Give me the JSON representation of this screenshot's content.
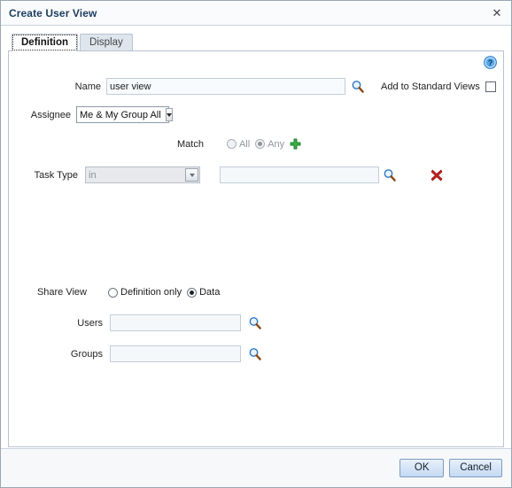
{
  "dialog": {
    "title": "Create User View",
    "close_label": "✕"
  },
  "tabs": [
    {
      "label": "Definition",
      "active": true
    },
    {
      "label": "Display",
      "active": false
    }
  ],
  "help": {
    "icon": "help-question-icon",
    "glyph": "?"
  },
  "form": {
    "name": {
      "label": "Name",
      "value": "user view",
      "placeholder": "",
      "search_icon": "magnifier-icon"
    },
    "add_to_standard_views": {
      "label": "Add to Standard Views",
      "checked": false
    },
    "assignee": {
      "label": "Assignee",
      "value": "Me & My Group All",
      "options": [
        "Me & My Group All"
      ]
    },
    "match": {
      "label": "Match",
      "options": [
        {
          "label": "All",
          "selected": false
        },
        {
          "label": "Any",
          "selected": true
        }
      ],
      "add_icon": "plus-icon",
      "disabled": true
    },
    "task_type": {
      "label": "Task Type",
      "operator_value": "in",
      "operator_options": [
        "in"
      ],
      "operator_disabled": true,
      "value": "",
      "placeholder": "",
      "search_icon": "magnifier-icon",
      "delete_icon": "delete-x-icon"
    },
    "share_view": {
      "label": "Share View",
      "options": [
        {
          "label": "Definition only",
          "selected": false
        },
        {
          "label": "Data",
          "selected": true
        }
      ]
    },
    "users": {
      "label": "Users",
      "value": "",
      "placeholder": "",
      "search_icon": "magnifier-icon"
    },
    "groups": {
      "label": "Groups",
      "value": "",
      "placeholder": "",
      "search_icon": "magnifier-icon"
    }
  },
  "footer": {
    "ok_label": "OK",
    "cancel_label": "Cancel"
  },
  "colors": {
    "title_text": "#1b3c5e",
    "panel_border": "#b8c4d2",
    "button_accent": "#c3daf3",
    "delete_icon": "#cc2222",
    "add_icon": "#33aa33",
    "help_icon": "#2a7fd4"
  }
}
